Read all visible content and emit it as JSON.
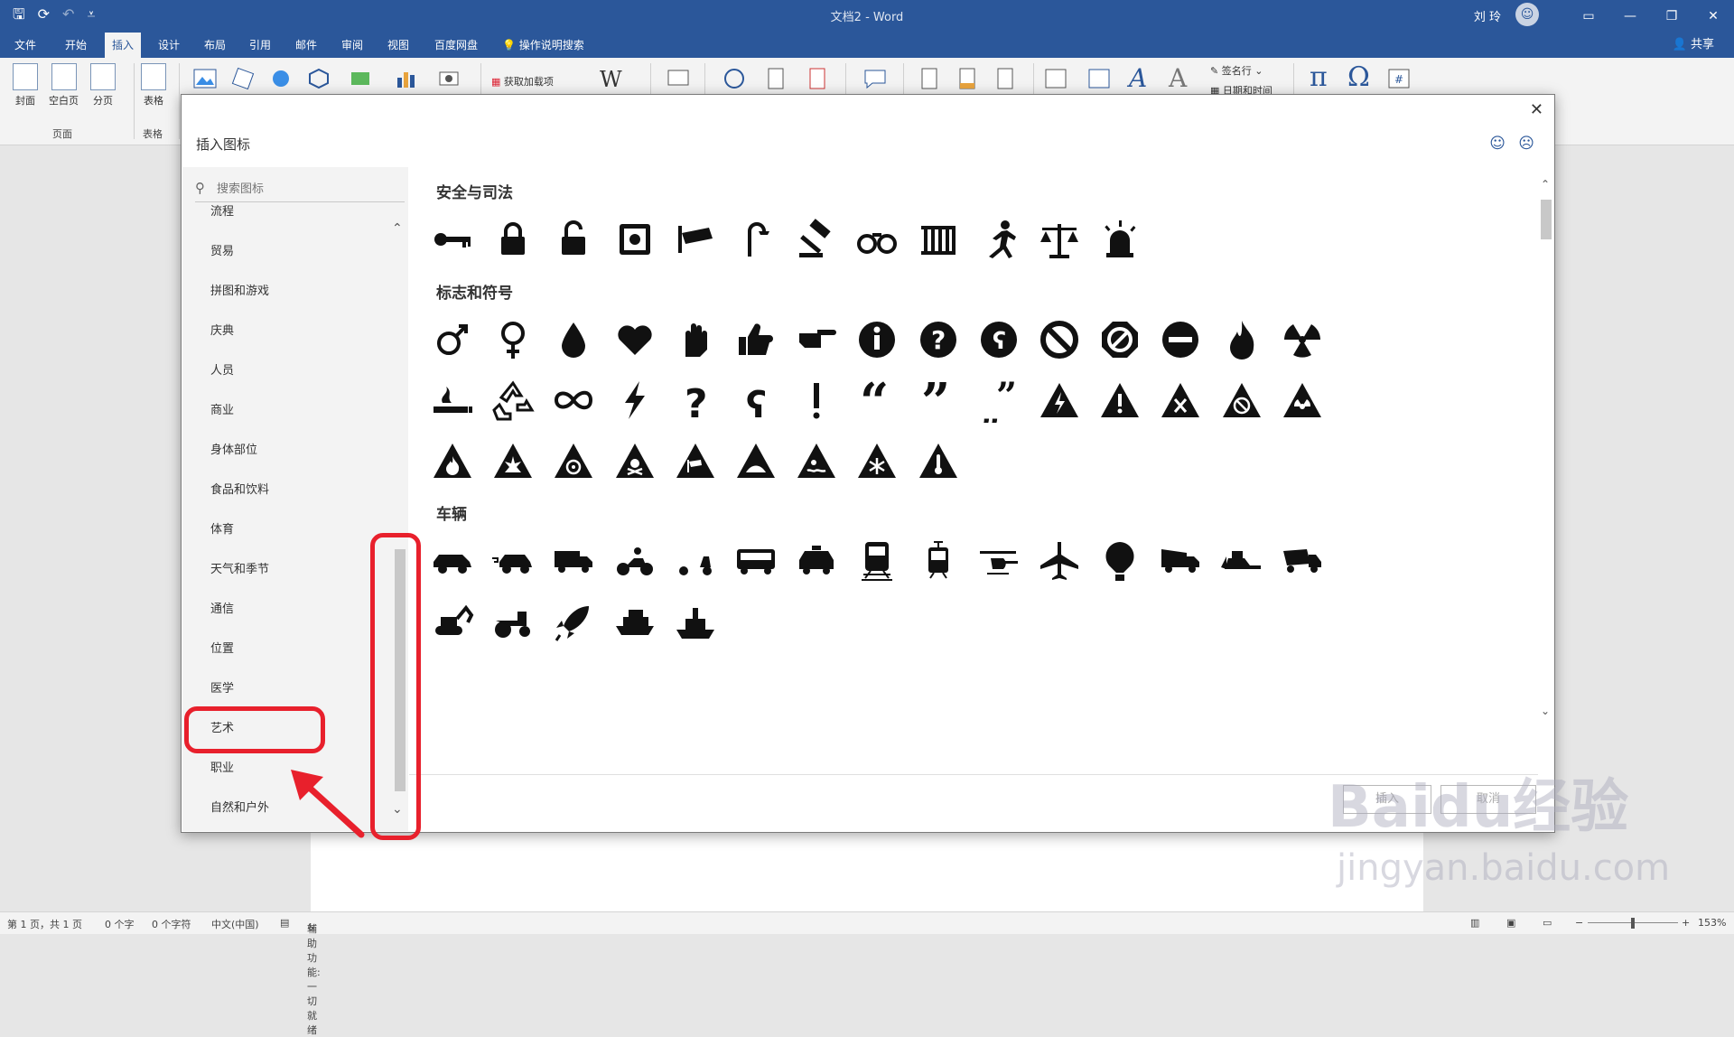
{
  "window": {
    "doc_title": "文档2 - Word",
    "user": "刘 玲",
    "share": "共享"
  },
  "tabs": [
    "文件",
    "开始",
    "插入",
    "设计",
    "布局",
    "引用",
    "邮件",
    "审阅",
    "视图",
    "百度网盘",
    "操作说明搜索"
  ],
  "ribbon": {
    "cover": "封面",
    "blank": "空白页",
    "break": "分页",
    "group_pages": "页面",
    "table": "表格",
    "group_table": "表格",
    "addins": "获取加载项",
    "signature": "签名行",
    "datetime": "日期和时间"
  },
  "dialog": {
    "title": "插入图标",
    "search_placeholder": "搜索图标",
    "categories": [
      "流程",
      "贸易",
      "拼图和游戏",
      "庆典",
      "人员",
      "商业",
      "身体部位",
      "食品和饮料",
      "体育",
      "天气和季节",
      "通信",
      "位置",
      "医学",
      "艺术",
      "职业",
      "自然和户外"
    ],
    "sections": [
      {
        "title": "安全与司法",
        "icons": [
          "key",
          "lock",
          "unlock",
          "safe",
          "security-camera",
          "streetlight",
          "gavel",
          "handcuffs",
          "jail",
          "runner",
          "scales",
          "siren"
        ]
      },
      {
        "title": "标志和符号",
        "icons": [
          "male",
          "female",
          "drop",
          "heart",
          "hand",
          "thumbs-up",
          "pointing-hand",
          "info",
          "question-circle",
          "hook-question-circle",
          "no-entry",
          "stop-octagon",
          "minus-circle",
          "fire",
          "radioactive",
          "smoking",
          "recycle",
          "infinity",
          "lightning",
          "question",
          "hook-question",
          "exclamation",
          "quote-open",
          "quote-close",
          "quote-split",
          "warning-electric",
          "warning",
          "warning-x",
          "warning-no",
          "warning-radiation",
          "warning-fire",
          "warning-explosion",
          "warning-biohazard",
          "warning-poison",
          "warning-camera",
          "warning-hill",
          "warning-water",
          "warning-snow",
          "warning-temperature"
        ]
      },
      {
        "title": "车辆",
        "icons": [
          "car",
          "electric-car",
          "truck",
          "motorcycle",
          "scooter",
          "bus",
          "taxi",
          "train",
          "tram",
          "helicopter",
          "airplane",
          "hot-air-balloon",
          "dump-truck",
          "bulldozer",
          "cement-mixer",
          "excavator",
          "tractor",
          "rocket",
          "cruise-ship",
          "ship"
        ]
      }
    ],
    "insert_button": "插入",
    "cancel_button": "取消"
  },
  "statusbar": {
    "page": "第 1 页，共 1 页",
    "words": "0 个字",
    "chars": "0 个字符",
    "lang": "中文(中国)",
    "accessibility": "辅助功能: 一切就绪",
    "zoom": "153%"
  },
  "watermark": {
    "line1": "Baidu经验",
    "line2": "jingyan.baidu.com"
  },
  "colors": {
    "accent": "#2b579a",
    "highlight": "#e8202c"
  }
}
